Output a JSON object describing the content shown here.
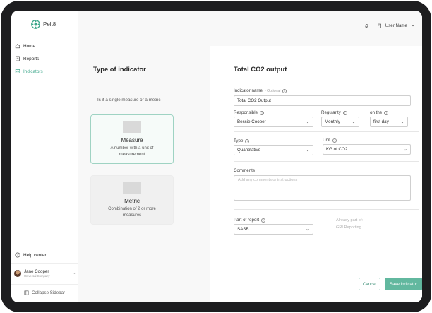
{
  "app": {
    "name": "Pelt8",
    "brand_color": "#3ba68a"
  },
  "sidebar": {
    "items": [
      {
        "label": "Home",
        "icon": "home-icon"
      },
      {
        "label": "Reports",
        "icon": "report-icon"
      },
      {
        "label": "Indicators",
        "icon": "indicators-icon",
        "active": true
      }
    ],
    "help_label": "Help center",
    "user": {
      "name": "Jane Cooper",
      "org": "Universal Company",
      "more": "..."
    },
    "collapse_label": "Collapse Sidebar"
  },
  "header": {
    "user_menu_label": "User Name"
  },
  "left_panel": {
    "title": "Type of indicator",
    "subtitle": "Is it a single measure or a metric",
    "options": [
      {
        "title": "Measure",
        "description": "A number with a unit of measurement",
        "selected": true
      },
      {
        "title": "Metric",
        "description": "Combination of 2 or more measures",
        "selected": false
      }
    ]
  },
  "form": {
    "title": "Total CO2 output",
    "indicator_name": {
      "label": "Indicator name",
      "optional": "- Optional",
      "value": "Total CO2 Output"
    },
    "responsible": {
      "label": "Responsible",
      "value": "Bessie Cooper"
    },
    "regularity": {
      "label": "Regularity",
      "value": "Monthly"
    },
    "on_the": {
      "label": "on the",
      "value": "first day"
    },
    "type": {
      "label": "Type",
      "value": "Quantitative"
    },
    "unit": {
      "label": "Unit",
      "value": "KG of CO2"
    },
    "comments": {
      "label": "Comments",
      "placeholder": "Add any comments or instructions"
    },
    "part_of_report": {
      "label": "Part of report",
      "value": "SASB"
    },
    "already_part_of": {
      "label": "Already part of:",
      "value": "GRI Reporting"
    },
    "cancel_label": "Cancel",
    "save_label": "Save indicator"
  }
}
